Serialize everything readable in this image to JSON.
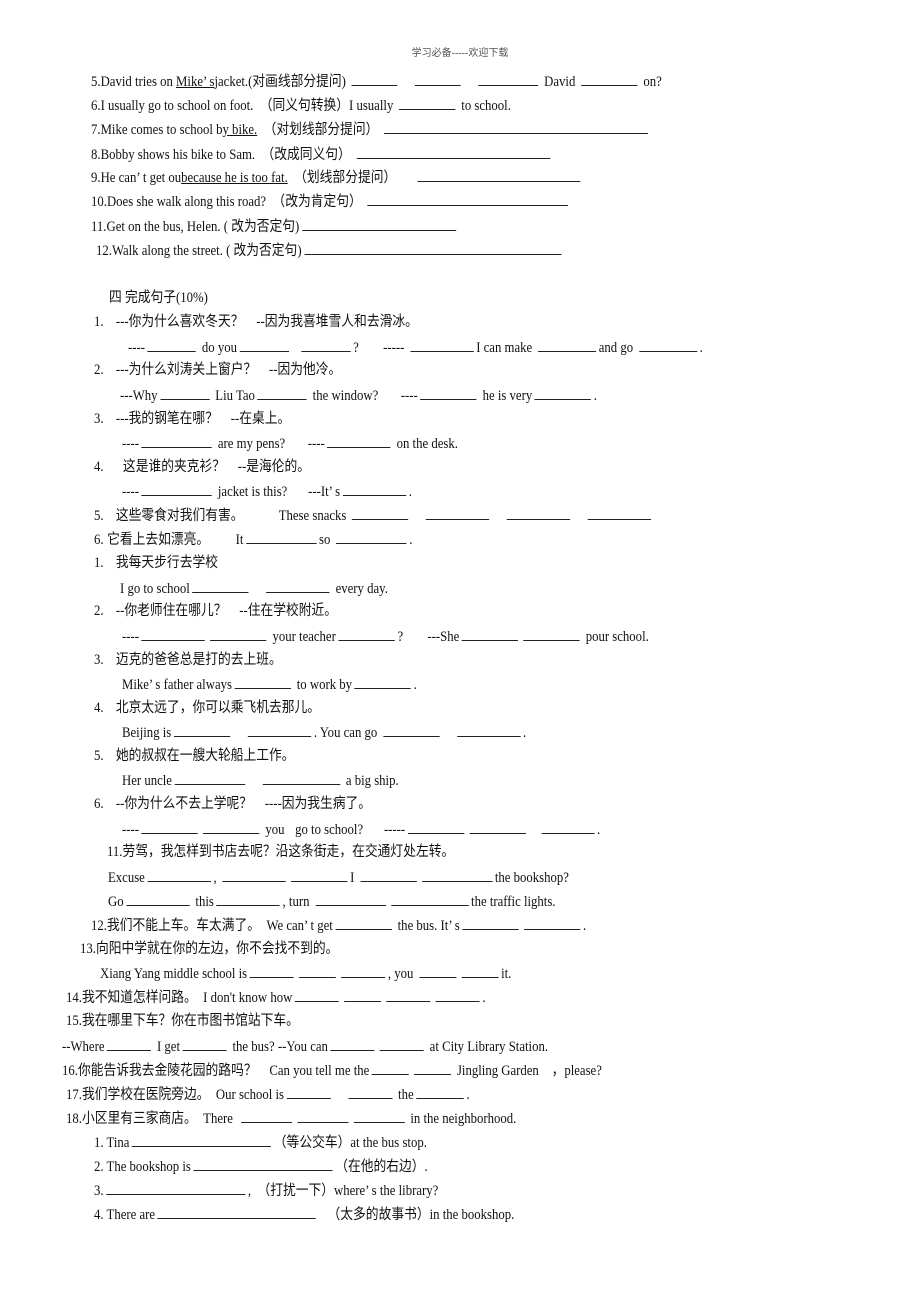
{
  "header": "学习必备-----欢迎下载",
  "part3": [
    {
      "pre": "5.David tries on ",
      "underlined": "Mike’ s",
      "post": "jacket.(对画线部分提问)",
      "tail": [
        "David",
        "on?"
      ]
    },
    {
      "text": "6.I usually go to school on foot.　（同义句转换）I usually",
      "tail": "to school."
    },
    {
      "pre": "7.Mike comes to school b",
      "underlined": "y bike.",
      "post": "　（对划线部分提问）"
    },
    {
      "text": "8.Bobby shows his bike to Sam.　（改成同义句）"
    },
    {
      "pre": "9.He can’ t get ou",
      "underlined": "because he is too fat.",
      "post": "　（划线部分提问）"
    },
    {
      "text": "10.Does she walk along this road?　（改为肯定句）"
    },
    {
      "text": "11.Get on the bus, Helen. ( 改为否定句)"
    },
    {
      "text": "12.Walk along the street. ( 改为否定句)"
    }
  ],
  "section4": {
    "title": "四  完成句子(10%)",
    "items": [
      {
        "num": "1.",
        "cn": "---你为什么喜欢冬天？　--因为我喜堆雪人和去滑冰。",
        "en": [
          "----",
          "do you",
          "?",
          "-----",
          "I can make",
          "and go",
          "."
        ]
      },
      {
        "num": "2.",
        "cn": "---为什么刘涛关上窗户？　--因为他冷。",
        "en": [
          "---Why",
          "Liu Tao",
          "the window?",
          "----",
          "he is very",
          "."
        ]
      },
      {
        "num": "3.",
        "cn": "---我的钢笔在哪？　--在桌上。",
        "en": [
          "----",
          "are my pens?",
          "----",
          "on the desk."
        ]
      },
      {
        "num": "4.",
        "cn": "这是谁的夹克衫？　--是海伦的。",
        "en": [
          "----",
          "jacket is this?",
          "---It’ s",
          "."
        ]
      },
      {
        "num": "5.",
        "cn": "这些零食对我们有害。",
        "en": [
          "These snacks"
        ]
      },
      {
        "num": "6.",
        "cn": "它看上去如漂亮。",
        "en": [
          "It",
          "so",
          "."
        ]
      }
    ],
    "items_b": [
      {
        "num": "1.",
        "cn": "我每天步行去学校",
        "en": [
          "I go to school",
          "every day."
        ]
      },
      {
        "num": "2.",
        "cn": "--你老师住在哪儿？　--住在学校附近。",
        "en": [
          "----",
          "your teacher",
          "?",
          "---She",
          "pour school."
        ]
      },
      {
        "num": "3.",
        "cn": "迈克的爸爸总是打的去上班。",
        "en": [
          "Mike’ s father always",
          "to work by",
          "."
        ]
      },
      {
        "num": "4.",
        "cn": "北京太远了，你可以乘飞机去那儿。",
        "en": [
          "Beijing is",
          ". You can go",
          "."
        ]
      },
      {
        "num": "5.",
        "cn": "她的叔叔在一艘大轮船上工作。",
        "en": [
          "Her uncle",
          "a big ship."
        ]
      },
      {
        "num": "6.",
        "cn": "--你为什么不去上学呢？　----因为我生病了。",
        "en": [
          "----",
          "you",
          "go to school?",
          "-----",
          "."
        ]
      }
    ],
    "items_c": {
      "q11_cn": "11.劳驾，我怎样到书店去呢？沿这条街走，在交通灯处左转。",
      "q11_en1": [
        "Excuse",
        ",",
        "I",
        "the bookshop?"
      ],
      "q11_en2": [
        "Go",
        "this",
        ", turn",
        "the traffic lights."
      ],
      "q12": [
        "12.我们不能上车。车太满了。　We can’ t get",
        "the bus. It’ s",
        "."
      ],
      "q13_cn": "13.向阳中学就在你的左边，你不会找不到的。",
      "q13_en": [
        "Xiang Yang middle school is",
        ", you",
        "it."
      ],
      "q14": [
        "14.我不知道怎样问路。　I don't know how",
        "."
      ],
      "q15_cn": "15.我在哪里下车？你在市图书馆站下车。",
      "q15_en": [
        "--Where",
        "I get",
        "the bus?  --You can",
        "at City Library Station."
      ],
      "q16": [
        "16.你能告诉我去金陵花园的路吗？　Can you tell me the",
        "Jingling Garden　，please?"
      ],
      "q17": [
        "17.我们学校在医院旁边。　Our school is",
        "the",
        "."
      ],
      "q18": [
        "18.小区里有三家商店。　There",
        "in the neighborhood."
      ]
    },
    "final": [
      {
        "pre": "1. Tina",
        "post": "（等公交车）at the bus stop."
      },
      {
        "pre": "2. The bookshop is",
        "post": "（在他的右边）."
      },
      {
        "pre": "3.",
        "post": ",　（打扰一下）where’ s the library?"
      },
      {
        "pre": "4. There are",
        "post": "（太多的故事书）in the bookshop."
      }
    ]
  }
}
